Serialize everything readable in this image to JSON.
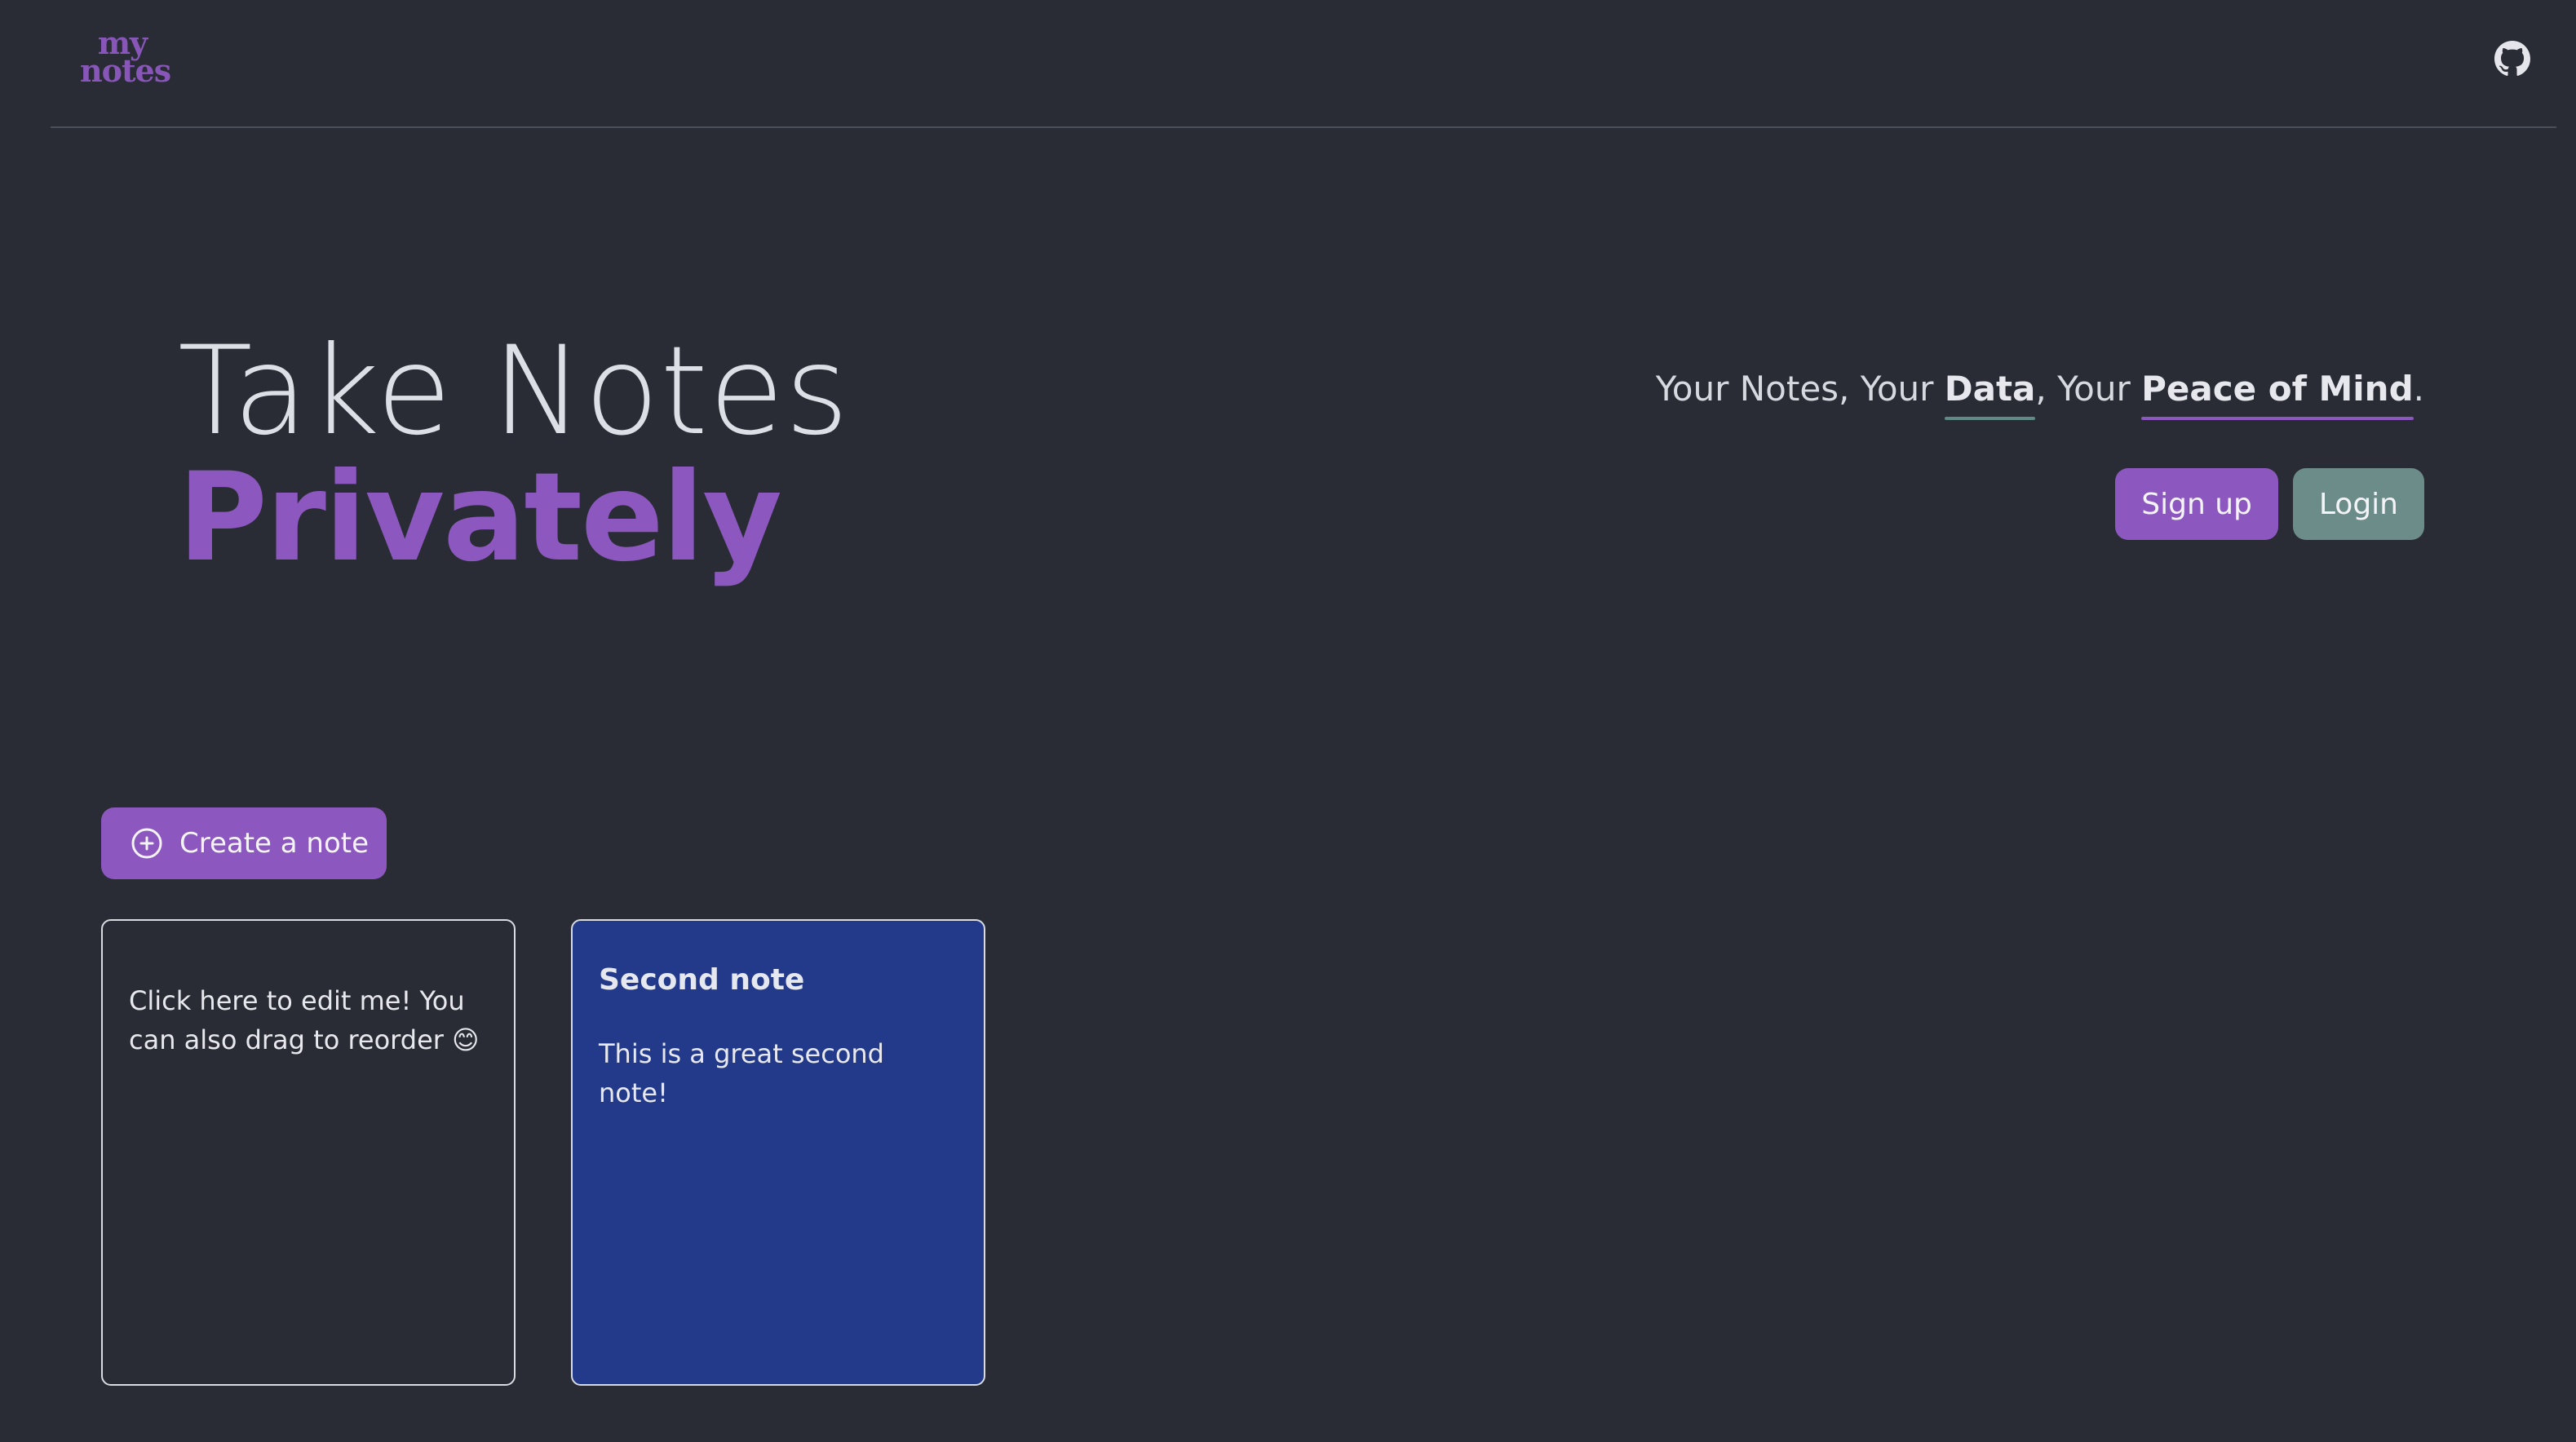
{
  "header": {
    "logo_line1": "my",
    "logo_line2": "notes",
    "github_icon": "github-icon"
  },
  "hero": {
    "line1": "Take Notes",
    "line2": "Privately"
  },
  "tagline": {
    "part1": "Your Notes, Your ",
    "data": "Data",
    "part2": ", Your ",
    "peace": "Peace of Mind",
    "end": "."
  },
  "auth": {
    "signup_label": "Sign up",
    "login_label": "Login"
  },
  "create": {
    "label": "Create a note",
    "icon": "plus-circle-icon"
  },
  "notes": [
    {
      "title": "",
      "body": "Click here to edit me! You can also drag to reorder 😊"
    },
    {
      "title": "Second note",
      "body": "This is a great second note!"
    }
  ],
  "colors": {
    "background": "#292c34",
    "accent": "#8c58bf",
    "secondary": "#6c8c8a",
    "note_blue": "#23398a"
  }
}
